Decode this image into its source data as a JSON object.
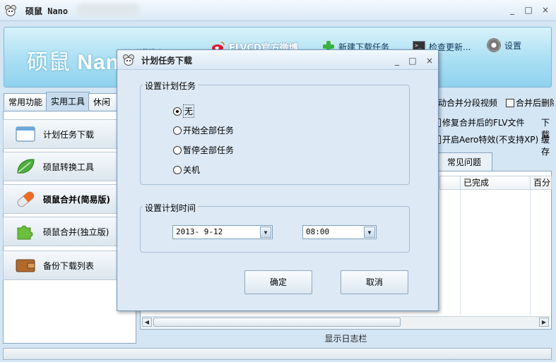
{
  "window": {
    "title": "硕鼠 Nano",
    "controls": [
      "_",
      "□",
      "×"
    ]
  },
  "banner": {
    "logo_cn": "硕鼠",
    "logo_en": "Nan",
    "sub_label": "单鼠版时",
    "weibo": "FLVCD官方微博",
    "new_task": "新建下载任务",
    "check_update": "检查更新...",
    "settings": "设置"
  },
  "tabs": [
    "常用功能",
    "实用工具",
    "休闲游"
  ],
  "left_nav": [
    {
      "label": "计划任务下载",
      "icon": "window-icon"
    },
    {
      "label": "硕鼠转换工具",
      "icon": "leaf-icon"
    },
    {
      "label": "硕鼠合并(简易版)",
      "icon": "capsule-icon"
    },
    {
      "label": "硕鼠合并(独立版)",
      "icon": "puzzle-icon"
    },
    {
      "label": "备份下载列表",
      "icon": "wallet-icon"
    }
  ],
  "options": {
    "merge_segments": "动合并分段视频",
    "delete_after_merge": "合并后删除",
    "fix_flv": "修复合并后的FLV文件",
    "download_cut": "下载",
    "aero": "开启Aero特效(不支持XP)",
    "cache_cut": "缓存"
  },
  "faq_tab": "常见问题",
  "columns": [
    "已完成",
    "百分"
  ],
  "log_bar": "显示日志栏",
  "dialog": {
    "title": "计划任务下载",
    "group_task": "设置计划任务",
    "radios": [
      {
        "label": "无",
        "checked": true
      },
      {
        "label": "开始全部任务",
        "checked": false
      },
      {
        "label": "暂停全部任务",
        "checked": false
      },
      {
        "label": "关机",
        "checked": false
      }
    ],
    "group_time": "设置计划时间",
    "date_value": "2013- 9-12",
    "time_value": "08:00",
    "ok": "确定",
    "cancel": "取消"
  }
}
